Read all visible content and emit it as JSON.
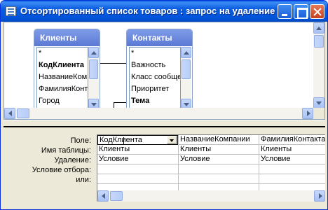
{
  "window": {
    "title": "Отсортированный список товаров : запрос на удаление"
  },
  "tables": [
    {
      "name": "Клиенты",
      "fields": [
        "*",
        "КодКлиента",
        "НазваниеКомпании",
        "ФамилияКонтакта",
        "Город"
      ]
    },
    {
      "name": "Контакты",
      "fields": [
        "*",
        "Важность",
        "Класс сообщения",
        "Приоритет",
        "Тема"
      ]
    }
  ],
  "grid": {
    "row_labels": [
      "Поле:",
      "Имя таблицы:",
      "Удаление:",
      "Условие отбора:",
      "или:"
    ],
    "columns": [
      {
        "field": "КодКлиента",
        "table": "Клиенты",
        "delete": "Условие",
        "criteria": "",
        "or": ""
      },
      {
        "field": "НазваниеКомпании",
        "table": "Клиенты",
        "delete": "Условие",
        "criteria": "",
        "or": ""
      },
      {
        "field": "ФамилияКонтакта",
        "table": "Клиенты",
        "delete": "Условие",
        "criteria": "",
        "or": ""
      }
    ]
  },
  "icons": {
    "app": "query-design-icon",
    "minimize": "minimize-icon",
    "maximize": "maximize-icon",
    "close": "close-icon",
    "dropdown": "chevron-down-icon"
  },
  "colors": {
    "titlebar": "#0053d8",
    "table_header": "#6d8ade",
    "window_bg": "#ece9d8"
  }
}
